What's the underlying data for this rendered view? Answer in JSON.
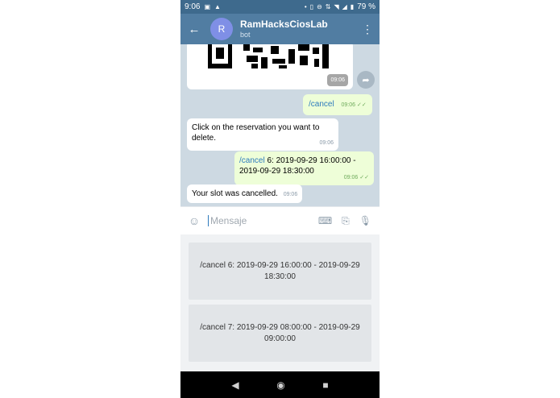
{
  "status_bar": {
    "time": "9:06",
    "battery": "79 %"
  },
  "header": {
    "back_icon": "arrow-left-icon",
    "avatar_letter": "R",
    "title": "RamHacksCiosLab",
    "subtitle": "bot",
    "menu_icon": "more-vertical-icon"
  },
  "chat": {
    "qr_time": "09:06",
    "messages": [
      {
        "dir": "out",
        "command": "/cancel",
        "text": "",
        "time": "09:06"
      },
      {
        "dir": "in",
        "text": "Click on the reservation you want to delete.",
        "time": "09:06"
      },
      {
        "dir": "out",
        "command": "/cancel",
        "text": " 6: 2019-09-29 16:00:00 - 2019-09-29 18:30:00",
        "time": "09:06"
      },
      {
        "dir": "in",
        "text": "Your slot was cancelled.",
        "time": "09:06"
      }
    ]
  },
  "input_bar": {
    "placeholder": "Mensaje"
  },
  "keyboard": {
    "buttons": [
      "/cancel 6: 2019-09-29 16:00:00 - 2019-09-29 18:30:00",
      "/cancel 7: 2019-09-29 08:00:00 - 2019-09-29 09:00:00"
    ]
  },
  "colors": {
    "header": "#517da2",
    "status_bar": "#3e6a8d",
    "outgoing_bubble": "#eefed8",
    "incoming_bubble": "#ffffff",
    "chat_background": "#cdd9e2"
  }
}
